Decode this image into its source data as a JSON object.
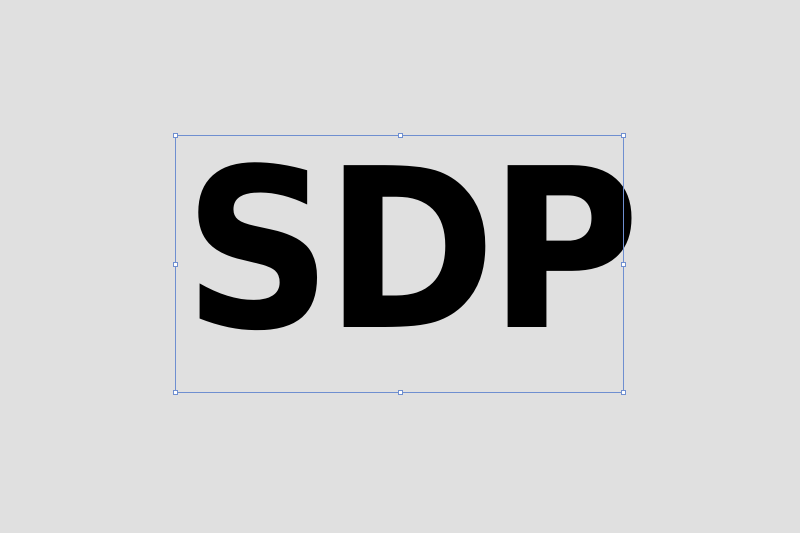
{
  "canvas": {
    "background_color": "#e0e0e0"
  },
  "text_object": {
    "content": "SDP",
    "color": "#000000",
    "selected": true
  },
  "selection": {
    "border_color": "#6f8fd0",
    "handle_fill": "#ffffff"
  }
}
